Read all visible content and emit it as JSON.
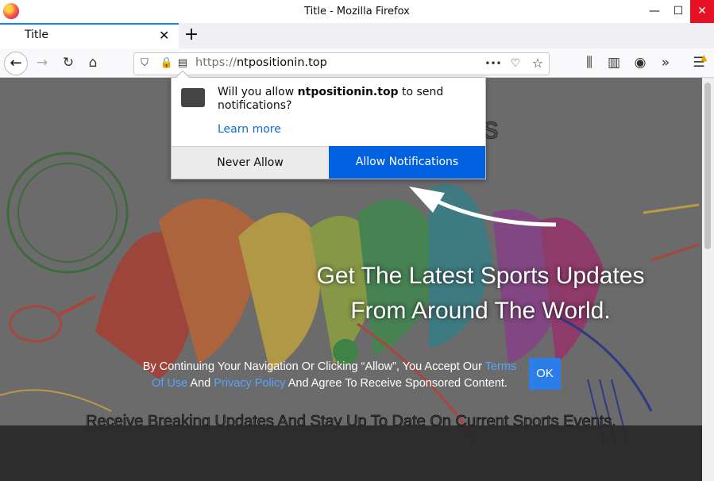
{
  "window": {
    "title": "Title - Mozilla Firefox",
    "minimize": "—",
    "maximize": "☐",
    "close": "✕"
  },
  "tab": {
    "title": "Title",
    "close": "✕",
    "new_tab": "+"
  },
  "nav": {
    "url_protocol": "https://",
    "url_host": "ntpositionin.top",
    "more": "•••"
  },
  "popup": {
    "text_before": "Will you allow ",
    "site": "ntpositionin.top",
    "text_after": " to send notifications?",
    "learn_more": "Learn more",
    "never_allow": "Never Allow",
    "allow": "Allow Notifications"
  },
  "page": {
    "heading": "Get The Latest Sports",
    "hero_line1": "Get The Latest Sports Updates",
    "hero_line2": "From Around The World.",
    "sub": "Receive Breaking Updates And Stay Up To Date On Current Sports Events."
  },
  "consent": {
    "part1": "By Continuing Your Navigation Or Clicking “Allow”, You Accept Our ",
    "terms": "Terms Of Use",
    "part2": " And ",
    "privacy": "Privacy Policy",
    "part3": " And Agree To Receive Sponsored Content.",
    "ok": "OK"
  },
  "colors": {
    "allow_button": "#0061e0",
    "close_button": "#e81123",
    "ok_button": "#2b7de9",
    "link": "#5aa2ff"
  }
}
